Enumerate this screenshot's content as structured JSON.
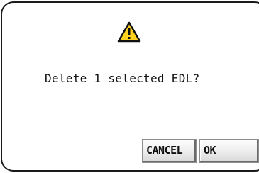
{
  "dialog": {
    "icon": "warning-icon",
    "message": "Delete 1 selected EDL?",
    "buttons": {
      "cancel_label": "CANCEL",
      "ok_label": "OK"
    }
  },
  "colors": {
    "warning_fill": "#ffd21f",
    "border": "#1a1a1a",
    "text": "#111111"
  }
}
